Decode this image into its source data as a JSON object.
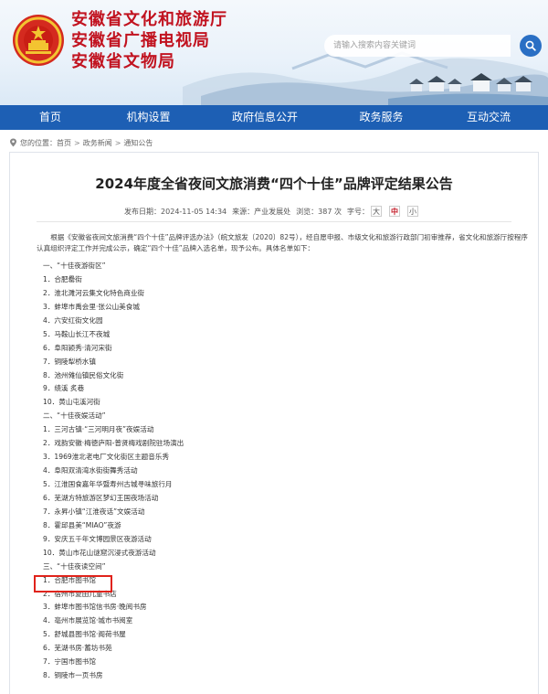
{
  "header": {
    "brand_lines": [
      "安徽省文化和旅游厅",
      "安徽省广播电视局",
      "安徽省文物局"
    ],
    "search_placeholder": "请输入搜索内容关键词",
    "colors": {
      "brand_red": "#c1121f",
      "nav_blue": "#1d5fb4"
    }
  },
  "nav": {
    "items": [
      "首页",
      "机构设置",
      "政府信息公开",
      "政务服务",
      "互动交流"
    ]
  },
  "breadcrumb": {
    "prefix": "您的位置：",
    "items": [
      "首页",
      "政务新闻",
      "通知公告"
    ]
  },
  "article": {
    "title": "2024年度全省夜间文旅消费“四个十佳”品牌评定结果公告",
    "meta": {
      "date": "发布日期：2024-11-05 14:34",
      "source": "来源：产业发展处",
      "views": "浏览：387 次",
      "font_label": "字号：",
      "font_sizes": [
        "大",
        "中",
        "小"
      ],
      "font_active": "中"
    },
    "intro": "根据《安徽省夜间文旅消费“四个十佳”品牌评选办法》（皖文旅发〔2020〕82号），经自愿申报、市级文化和旅游行政部门初审推荐，省文化和旅游厅按程序认真组织评定工作并完成公示，确定“四个十佳”品牌入选名单，现予公布。具体名单如下：",
    "lines": [
      "一、“十佳夜游街区”",
      "1．合肥罍街",
      "2．淮北濉河云集文化特色商业街",
      "3．蚌埠市禹会里·张公山美食城",
      "4．六安红街文化园",
      "5．马鞍山长江不夜城",
      "6．阜阳颍秀·清河宋街",
      "7．铜陵犁桥水镇",
      "8．池州傩仙镇民俗文化街",
      "9．绩溪 炙巷",
      "10．黄山屯溪河街",
      "二、“十佳夜娱活动”",
      "1．三河古镇·“三河明月夜”夜娱活动",
      "2．戏韵安徽·梅徳庐阳-普贤梅戏剧院驻场演出",
      "3．1969淮北老电厂文化街区主题音乐秀",
      "4．阜阳双清湾水街街舞秀活动",
      "5．江淮国食嘉年华暨寿州古城寻味旅行月",
      "6．芜湖方特旅游区梦幻王国夜场活动",
      "7．永昇小镇“江淮夜话”文娱活动",
      "8．霍邱县美“MIAO”夜游",
      "9．安庆五千年文博园景区夜游活动",
      "10．黄山市花山谜窟沉浸式夜游活动",
      "三、“十佳夜读空间”",
      "1．合肥市图书馆",
      "2．宿州市夏田儿童书店",
      "3．蚌埠市图书馆信书房·晚阅书房",
      "4．亳州市展览馆·城市书阅室",
      "5．舒城县图书馆·阁荷书屋",
      "6．芜湖书房·蓄坊书苑",
      "7．宁国市图书馆",
      "8．铜陵市一页书房"
    ]
  }
}
